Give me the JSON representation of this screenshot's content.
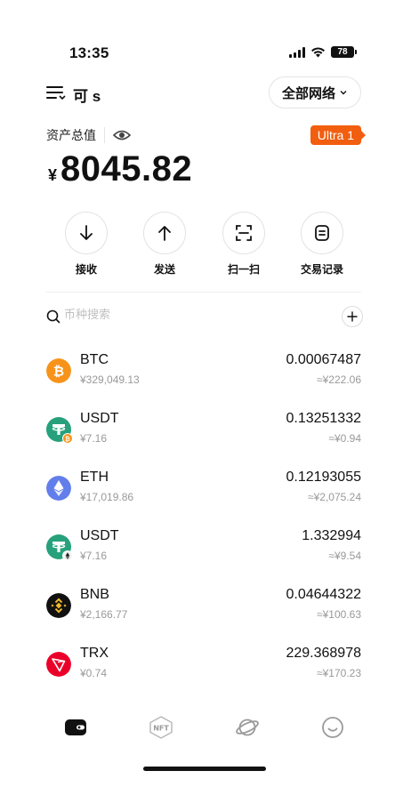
{
  "status_bar": {
    "time": "13:35",
    "battery": "78"
  },
  "header": {
    "account_name": "可 s",
    "network_label": "全部网络"
  },
  "asset": {
    "label": "资产总值",
    "currency_symbol": "¥",
    "total": "8045.82",
    "badge": "Ultra 1"
  },
  "actions": [
    {
      "label": "接收",
      "icon": "arrow-down-icon"
    },
    {
      "label": "发送",
      "icon": "arrow-up-icon"
    },
    {
      "label": "扫一扫",
      "icon": "scan-icon"
    },
    {
      "label": "交易记录",
      "icon": "list-icon"
    }
  ],
  "search": {
    "placeholder": "币种搜索"
  },
  "tokens": [
    {
      "symbol": "BTC",
      "price": "¥329,049.13",
      "amount": "0.00067487",
      "value": "≈¥222.06",
      "color": "#f7931a",
      "icon": "btc-icon"
    },
    {
      "symbol": "USDT",
      "price": "¥7.16",
      "amount": "0.13251332",
      "value": "≈¥0.94",
      "color": "#26a17b",
      "icon": "usdt-icon",
      "chain_badge": "btc"
    },
    {
      "symbol": "ETH",
      "price": "¥17,019.86",
      "amount": "0.12193055",
      "value": "≈¥2,075.24",
      "color": "#627eea",
      "icon": "eth-icon"
    },
    {
      "symbol": "USDT",
      "price": "¥7.16",
      "amount": "1.332994",
      "value": "≈¥9.54",
      "color": "#26a17b",
      "icon": "usdt-icon",
      "chain_badge": "eth"
    },
    {
      "symbol": "BNB",
      "price": "¥2,166.77",
      "amount": "0.04644322",
      "value": "≈¥100.63",
      "color": "#111111",
      "icon": "bnb-icon"
    },
    {
      "symbol": "TRX",
      "price": "¥0.74",
      "amount": "229.368978",
      "value": "≈¥170.23",
      "color": "#eb0029",
      "icon": "trx-icon"
    }
  ],
  "bottom_nav": [
    {
      "icon": "wallet-icon",
      "active": true
    },
    {
      "icon": "nft-icon",
      "label": "NFT",
      "active": false
    },
    {
      "icon": "planet-icon",
      "active": false
    },
    {
      "icon": "smile-icon",
      "active": false
    }
  ],
  "colors": {
    "accent": "#f25e0f",
    "text": "#111111",
    "muted": "#999999"
  }
}
